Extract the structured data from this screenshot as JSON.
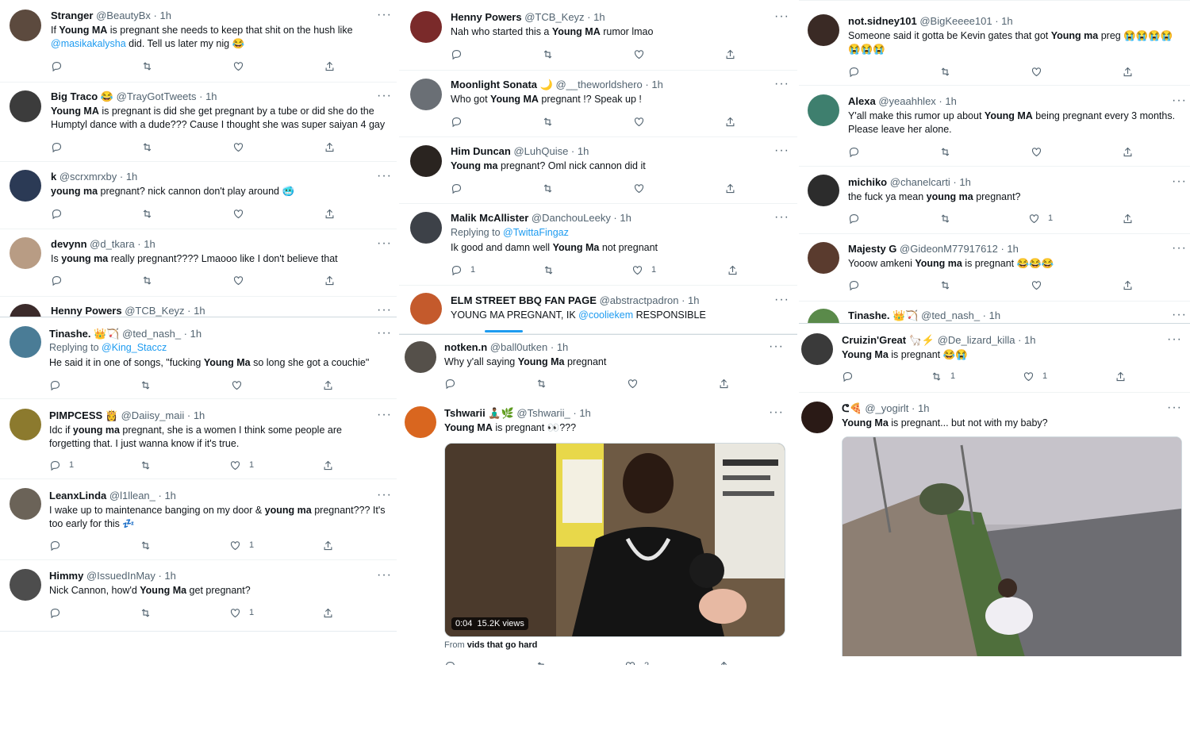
{
  "col1": {
    "tweets": [
      {
        "name": "Stranger",
        "handle": "@BeautyBx · 1h",
        "line1": [
          "If ",
          [
            "Young MA"
          ],
          " is pregnant she needs to keep that shit on the hush like"
        ],
        "line2": [
          {
            "link": "@masikakalysha"
          },
          " did. Tell us later my nig 😂"
        ]
      },
      {
        "name": "Big Traco 😂",
        "handle": "@TrayGotTweets · 1h",
        "line1": [
          [
            "Young MA"
          ],
          " is pregnant is did she get pregnant by a tube or did she do the"
        ],
        "line2": [
          "Humptyl dance with a dude??? Cause I thought she was super saiyan 4 gay"
        ]
      },
      {
        "name": "k",
        "handle": "@scrxmrxby · 1h",
        "line1": [
          [
            "young ma"
          ],
          " pregnant? nick cannon don't play around 🥶"
        ]
      },
      {
        "name": "devynn",
        "handle": "@d_tkara · 1h",
        "line1": [
          "Is ",
          [
            "young ma"
          ],
          " really pregnant???? Lmaooo like I don't believe that"
        ]
      },
      {
        "name": "Henny Powers",
        "handle": "@TCB_Keyz · 1h"
      },
      {
        "name": "Tinashe. 👑🏹",
        "handle": "@ted_nash_ · 1h",
        "replying": "Replying to",
        "replying_to": "@King_Staccz",
        "line1": [
          "He said it in one of songs, \"fucking ",
          [
            "Young Ma"
          ],
          " so long she got a couchie\""
        ]
      },
      {
        "name": "PIMPCESS 👸",
        "handle": "@Daiisy_maii · 1h",
        "line1": [
          "Idc if ",
          [
            "young ma"
          ],
          " pregnant, she is a women I think some people are"
        ],
        "line2": [
          "forgetting that. I just wanna know if it's true."
        ],
        "reply_count": "1",
        "like_count": "1"
      },
      {
        "name": "LeanxLinda",
        "handle": "@l1llean_ · 1h",
        "line1": [
          "I wake up to maintenance banging on my door & ",
          [
            "young ma"
          ],
          " pregnant??? It's"
        ],
        "line2": [
          "too early for this 💤"
        ],
        "like_count": "1"
      },
      {
        "name": "Himmy",
        "handle": "@IssuedInMay · 1h",
        "line1": [
          "Nick Cannon, how'd ",
          [
            "Young Ma"
          ],
          " get pregnant?"
        ],
        "like_count": "1"
      }
    ]
  },
  "col2": {
    "tweets": [
      {
        "name": "Henny Powers",
        "handle": "@TCB_Keyz · 1h",
        "line1": [
          "Nah who started this a ",
          [
            "Young MA"
          ],
          " rumor lmao"
        ]
      },
      {
        "name": "Moonlight Sonata 🌙",
        "handle": "@__theworldshero · 1h",
        "line1": [
          "Who got ",
          [
            "Young MA"
          ],
          " pregnant !? Speak up !"
        ]
      },
      {
        "name": "Him Duncan",
        "handle": "@LuhQuise · 1h",
        "line1": [
          [
            "Young ma"
          ],
          " pregnant? Oml nick cannon did it"
        ]
      },
      {
        "name": "Malik McAllister",
        "handle": "@DanchouLeeky · 1h",
        "replying": "Replying to",
        "replying_to": "@TwittaFingaz",
        "line1": [
          "Ik good and damn well ",
          [
            "Young Ma"
          ],
          " not pregnant"
        ],
        "reply_count": "1",
        "like_count": "1"
      },
      {
        "name": "ELM STREET BBQ FAN PAGE",
        "handle": "@abstractpadron · 1h",
        "line1": [
          "YOUNG MA PREGNANT, IK ",
          {
            "link": "@cooliekem"
          },
          " RESPONSIBLE"
        ]
      },
      {
        "name": "notken.n",
        "handle": "@ball0utken · 1h",
        "line1": [
          "Why y'all saying ",
          [
            "Young Ma"
          ],
          " pregnant"
        ]
      },
      {
        "name": "Tshwarii 🧘🏾‍♂️🌿",
        "handle": "@Tshwarii_ · 1h",
        "line1": [
          [
            "Young MA"
          ],
          " is pregnant 👀???"
        ],
        "video_time": "0:04",
        "video_views": "15.2K views",
        "from_label": "From",
        "from_source": "vids that go hard",
        "like_count": "2"
      }
    ]
  },
  "col3": {
    "tweets": [
      {
        "name": "not.sidney101",
        "handle": "@BigKeeee101 · 1h",
        "line1": [
          "Someone said it gotta be Kevin gates that got ",
          [
            "Young ma"
          ],
          " preg 😭😭😭😭"
        ],
        "line2": [
          "😭😭😭"
        ]
      },
      {
        "name": "Alexa",
        "handle": "@yeaahhlex · 1h",
        "line1": [
          "Y'all make this rumor up about ",
          [
            "Young MA"
          ],
          " being pregnant every 3 months."
        ],
        "line2": [
          "Please leave her alone."
        ]
      },
      {
        "name": "michiko",
        "handle": "@chanelcarti · 1h",
        "line1": [
          "the fuck ya mean ",
          [
            "young ma"
          ],
          " pregnant?"
        ],
        "like_count": "1"
      },
      {
        "name": "Majesty G",
        "handle": "@GideonM77917612 · 1h",
        "line1": [
          "Yooow amkeni ",
          [
            "Young ma"
          ],
          " is pregnant 😂😂😂"
        ]
      },
      {
        "name": "Tinashe. 👑🏹",
        "handle": "@ted_nash_ · 1h"
      },
      {
        "name": "Cruizin'Great 🦙⚡",
        "handle": "@De_lizard_killa · 1h",
        "line1": [
          [
            "Young Ma"
          ],
          " is pregnant 😂😭"
        ],
        "retweet_count": "1",
        "like_count": "1"
      },
      {
        "name": "ᕦ🍕",
        "handle": "@_yogirlt · 1h",
        "line1": [
          [
            "Young Ma"
          ],
          " is pregnant... but not with my baby?"
        ]
      }
    ]
  },
  "colors": {
    "text": "#0f1419",
    "muted": "#536471",
    "link": "#1d9bf0",
    "border": "#eff3f4"
  },
  "icons": [
    "reply-icon",
    "retweet-icon",
    "like-icon",
    "share-icon",
    "more-icon"
  ]
}
